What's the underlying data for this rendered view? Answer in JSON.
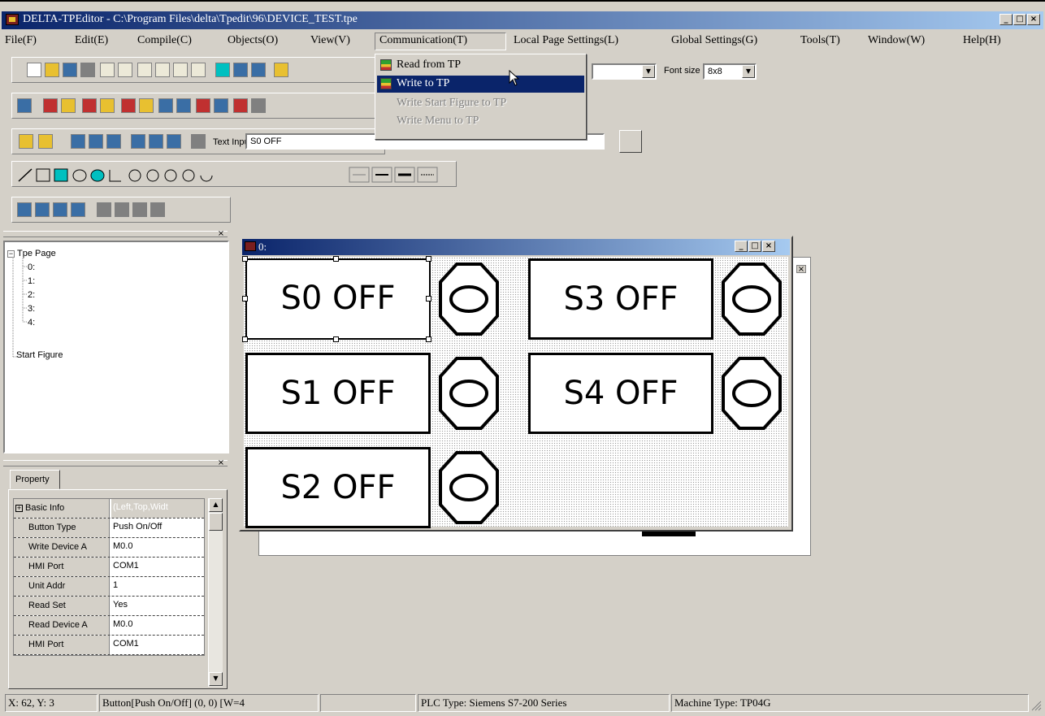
{
  "window": {
    "title": "DELTA-TPEditor - C:\\Program Files\\delta\\Tpedit\\96\\DEVICE_TEST.tpe"
  },
  "menubar": {
    "items": [
      "File(F)",
      "Edit(E)",
      "Compile(C)",
      "Objects(O)",
      "View(V)",
      "Communication(T)",
      "Local Page Settings(L)",
      "Global Settings(G)",
      "Tools(T)",
      "Window(W)",
      "Help(H)"
    ]
  },
  "comm_menu": {
    "items": [
      {
        "label": "Read from TP",
        "state": "normal"
      },
      {
        "label": "Write to TP",
        "state": "selected"
      },
      {
        "label": "Write Start Figure to TP",
        "state": "disabled"
      },
      {
        "label": "Write Menu to TP",
        "state": "disabled"
      }
    ]
  },
  "toolbar": {
    "font_size_label": "Font size",
    "font_size_value": "8x8",
    "text_input_label": "Text Input",
    "text_input_value": "S0 OFF"
  },
  "tree": {
    "root": "Tpe Page",
    "pages": [
      "0:",
      "1:",
      "2:",
      "3:",
      "4:"
    ],
    "start_figure": "Start Figure"
  },
  "property": {
    "tab": "Property",
    "rows": [
      {
        "key": "Basic Info",
        "value": "(Left,Top,Widt"
      },
      {
        "key": "Button Type",
        "value": "Push On/Off"
      },
      {
        "key": "Write Device A",
        "value": "M0.0"
      },
      {
        "key": "HMI Port",
        "value": "COM1"
      },
      {
        "key": "Unit Addr",
        "value": "1"
      },
      {
        "key": "Read Set",
        "value": "Yes"
      },
      {
        "key": "Read Device A",
        "value": "M0.0"
      },
      {
        "key": "HMI Port",
        "value": "COM1"
      }
    ]
  },
  "mdi": {
    "title": "0:",
    "buttons": [
      "S0 OFF",
      "S1 OFF",
      "S2 OFF",
      "S3 OFF",
      "S4 OFF"
    ]
  },
  "statusbar": {
    "coords": "X: 62, Y: 3",
    "object": "Button[Push On/Off] (0, 0) [W=4",
    "plc_type": "PLC Type: Siemens S7-200 Series",
    "machine_type": "Machine Type: TP04G"
  },
  "colors": {
    "titlebar_start": "#0a246a",
    "titlebar_end": "#a6caf0",
    "face": "#d4d0c8",
    "selection": "#0a246a"
  }
}
